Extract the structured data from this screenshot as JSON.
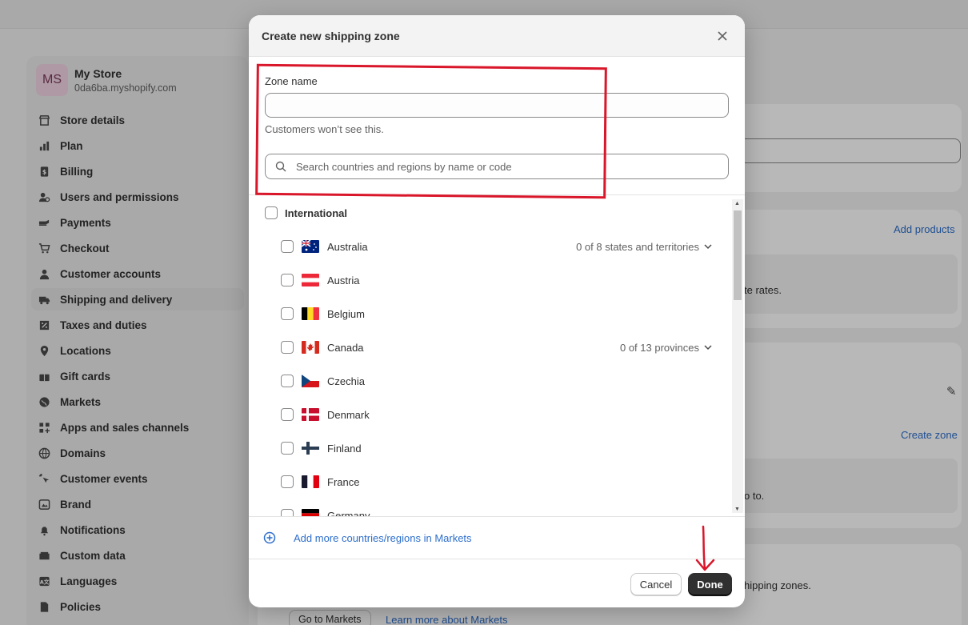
{
  "store": {
    "initials": "MS",
    "name": "My Store",
    "domain": "0da6ba.myshopify.com"
  },
  "sidebar": {
    "items": [
      {
        "label": "Store details",
        "icon": "store-icon"
      },
      {
        "label": "Plan",
        "icon": "plan-icon"
      },
      {
        "label": "Billing",
        "icon": "billing-icon"
      },
      {
        "label": "Users and permissions",
        "icon": "users-icon"
      },
      {
        "label": "Payments",
        "icon": "payments-icon"
      },
      {
        "label": "Checkout",
        "icon": "cart-icon"
      },
      {
        "label": "Customer accounts",
        "icon": "person-icon"
      },
      {
        "label": "Shipping and delivery",
        "icon": "truck-icon",
        "active": true
      },
      {
        "label": "Taxes and duties",
        "icon": "tax-icon"
      },
      {
        "label": "Locations",
        "icon": "location-icon"
      },
      {
        "label": "Gift cards",
        "icon": "gift-icon"
      },
      {
        "label": "Markets",
        "icon": "globe-icon"
      },
      {
        "label": "Apps and sales channels",
        "icon": "apps-icon"
      },
      {
        "label": "Domains",
        "icon": "globe-icon"
      },
      {
        "label": "Customer events",
        "icon": "cursor-icon"
      },
      {
        "label": "Brand",
        "icon": "brand-icon"
      },
      {
        "label": "Notifications",
        "icon": "bell-icon"
      },
      {
        "label": "Custom data",
        "icon": "data-icon"
      },
      {
        "label": "Languages",
        "icon": "language-icon"
      },
      {
        "label": "Policies",
        "icon": "policy-icon"
      }
    ]
  },
  "background": {
    "add_products": "Add products",
    "rates_text": "te rates.",
    "create_zone": "Create zone",
    "to_text": "o to.",
    "shipping_zones_text": "hipping zones.",
    "go_to_markets": "Go to Markets",
    "learn_more": "Learn more about Markets"
  },
  "modal": {
    "title": "Create new shipping zone",
    "zone_name_label": "Zone name",
    "zone_name_value": "",
    "help_text": "Customers won’t see this.",
    "search_placeholder": "Search countries and regions by name or code",
    "international_label": "International",
    "countries": [
      {
        "name": "Australia",
        "sub": "0 of 8 states and territories"
      },
      {
        "name": "Austria",
        "sub": ""
      },
      {
        "name": "Belgium",
        "sub": ""
      },
      {
        "name": "Canada",
        "sub": "0 of 13 provinces"
      },
      {
        "name": "Czechia",
        "sub": ""
      },
      {
        "name": "Denmark",
        "sub": ""
      },
      {
        "name": "Finland",
        "sub": ""
      },
      {
        "name": "France",
        "sub": ""
      },
      {
        "name": "Germany",
        "sub": ""
      }
    ],
    "add_more_label": "Add more countries/regions in Markets",
    "cancel_label": "Cancel",
    "done_label": "Done"
  },
  "colors": {
    "accent": "#2c6ecb",
    "annotation": "#d9162a",
    "primary_button": "#303030"
  }
}
